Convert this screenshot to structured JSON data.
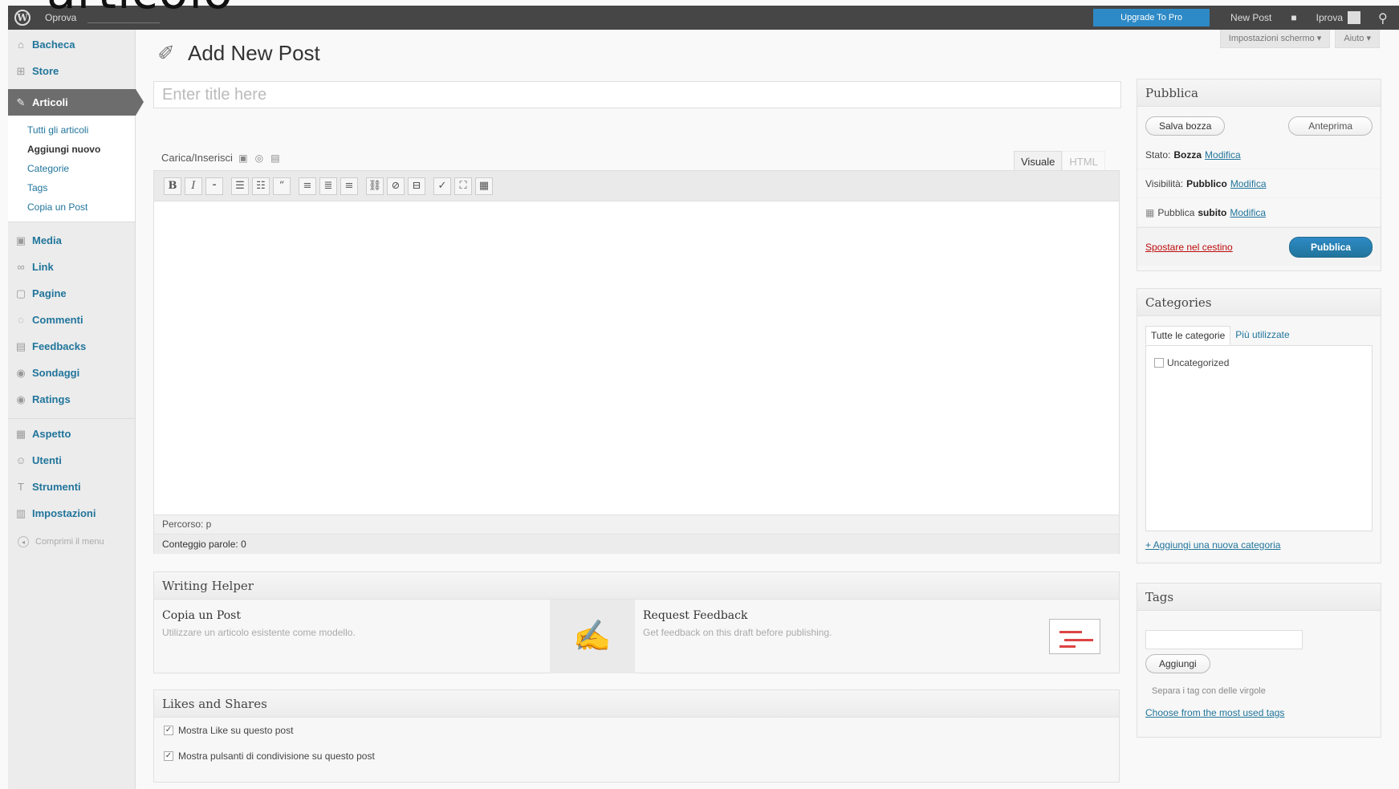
{
  "overlay_heading": "articolo",
  "admin_bar": {
    "site_name": "Oprova",
    "upgrade_label": "Upgrade To Pro",
    "new_post_label": "New Post",
    "user_label": "Iprova"
  },
  "sidebar": {
    "items_top": [
      {
        "label": "Bacheca",
        "icon": "home-icon"
      },
      {
        "label": "Store",
        "icon": "cart-icon"
      }
    ],
    "active_item": {
      "label": "Articoli",
      "icon": "pin-icon"
    },
    "submenu": [
      "Tutti gli articoli",
      "Aggiungi nuovo",
      "Categorie",
      "Tags",
      "Copia un Post"
    ],
    "items_mid": [
      {
        "label": "Media",
        "icon": "media-icon"
      },
      {
        "label": "Link",
        "icon": "link-icon"
      },
      {
        "label": "Pagine",
        "icon": "page-icon"
      },
      {
        "label": "Commenti",
        "icon": "comment-icon"
      },
      {
        "label": "Feedbacks",
        "icon": "feedback-icon"
      },
      {
        "label": "Sondaggi",
        "icon": "poll-icon"
      },
      {
        "label": "Ratings",
        "icon": "rating-icon"
      }
    ],
    "items_bottom": [
      {
        "label": "Aspetto",
        "icon": "appearance-icon"
      },
      {
        "label": "Utenti",
        "icon": "users-icon"
      },
      {
        "label": "Strumenti",
        "icon": "tools-icon"
      },
      {
        "label": "Impostazioni",
        "icon": "settings-icon"
      }
    ],
    "collapse_label": "Comprimi il menu"
  },
  "screen_options": {
    "screen_label": "Impostazioni schermo ▾",
    "help_label": "Aiuto ▾"
  },
  "page_title": "Add New Post",
  "title_placeholder": "Enter title here",
  "media_label": "Carica/Inserisci",
  "editor_tabs": {
    "visual": "Visuale",
    "html": "HTML"
  },
  "editor_path": "Percorso: p",
  "word_count": "Conteggio parole: 0",
  "writing_helper": {
    "title": "Writing Helper",
    "copy_title": "Copia un Post",
    "copy_desc": "Utilizzare un articolo esistente come modello.",
    "feedback_title": "Request Feedback",
    "feedback_desc": "Get feedback on this draft before publishing."
  },
  "likes": {
    "title": "Likes and Shares",
    "option1": "Mostra Like su questo post",
    "option2": "Mostra pulsanti di condivisione su questo post"
  },
  "publish": {
    "title": "Pubblica",
    "save_draft": "Salva bozza",
    "preview": "Anteprima",
    "status_label": "Stato:",
    "status_value": "Bozza",
    "visibility_label": "Visibilità:",
    "visibility_value": "Pubblico",
    "publish_label": "Pubblica",
    "publish_value": "subito",
    "edit_link": "Modifica",
    "trash_link": "Spostare nel cestino",
    "publish_button": "Pubblica"
  },
  "categories": {
    "title": "Categories",
    "tab_all": "Tutte le categorie",
    "tab_popular": "Più utilizzate",
    "items": [
      "Uncategorized"
    ],
    "add_link": "+ Aggiungi una nuova categoria"
  },
  "tags": {
    "title": "Tags",
    "add_button": "Aggiungi",
    "hint": "Separa i tag con delle virgole",
    "choose_link": "Choose from the most used tags"
  }
}
